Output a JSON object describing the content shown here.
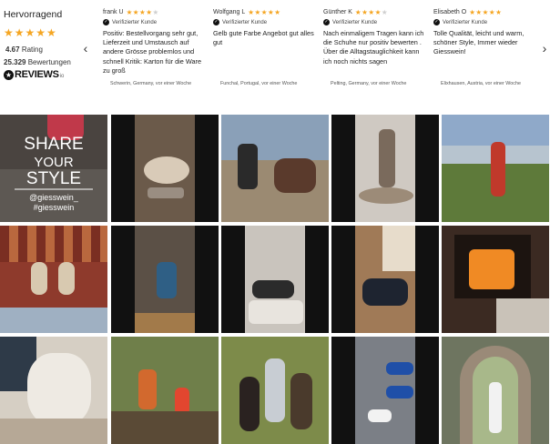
{
  "summary": {
    "title": "Hervorragend",
    "stars": "★★★★★",
    "rating_value": "4.67",
    "rating_label": "Rating",
    "count_value": "25.329",
    "count_label": "Bewertungen",
    "brand": "REVIEWS",
    "brand_suffix": "io"
  },
  "nav": {
    "prev": "‹",
    "next": "›"
  },
  "reviews": [
    {
      "name": "frank U",
      "stars_on": "★★★★",
      "stars_off": "★",
      "verified": "Verifizierter Kunde",
      "text": "Positiv: Bestellvorgang sehr gut, Lieferzeit und Umstausch auf andere Grösse problemlos und schnell Kritik: Karton für die Ware zu groß",
      "location": "Schwerin, Germany, vor einer Woche"
    },
    {
      "name": "Wolfgang L",
      "stars_on": "★★★★★",
      "stars_off": "",
      "verified": "Verifizierter Kunde",
      "text": "Gelb gute Farbe Angebot gut alles gut",
      "location": "Funchal, Portugal, vor einer Woche"
    },
    {
      "name": "Günther K",
      "stars_on": "★★★★",
      "stars_off": "★",
      "verified": "Verifizierter Kunde",
      "text": "Nach einmaligem Tragen kann ich die Schuhe nur positiv bewerten . Über die Alltagstauglichkeit kann ich noch nichts sagen",
      "location": "Pelting, Germany, vor einer Woche"
    },
    {
      "name": "Elisabeth O",
      "stars_on": "★★★★★",
      "stars_off": "",
      "verified": "Verifizierter Kunde",
      "text": "Tolle Qualität, leicht und warm, schöner Style, Immer wieder Giesswein!",
      "location": "Elixhausen, Austria, vor einer Woche"
    }
  ],
  "share_tile": {
    "line1": "SHARE",
    "line2": "YOUR",
    "line3": "STYLE",
    "handle": "@giesswein_",
    "hashtag": "#giesswein"
  },
  "photos": [
    {
      "name": "photo-dog-on-shoes",
      "bg": "#6b5a4a",
      "accent": "#d9cbb8"
    },
    {
      "name": "photo-man-with-pony",
      "bg": "#8aa0b8",
      "accent": "#3a3230"
    },
    {
      "name": "photo-woman-mirror-shoes",
      "bg": "#cfc9c2",
      "accent": "#7a6a5c"
    },
    {
      "name": "photo-woman-by-lake",
      "bg": "#8fa9c9",
      "accent": "#c0392b"
    },
    {
      "name": "photo-slippers-on-rug",
      "bg": "#8e3a2c",
      "accent": "#d8c9b0"
    },
    {
      "name": "photo-woman-sitting-hall",
      "bg": "#5b5046",
      "accent": "#2f5f85"
    },
    {
      "name": "photo-putting-on-shoes",
      "bg": "#c9c4bd",
      "accent": "#2b2b2b"
    },
    {
      "name": "photo-tying-sneaker",
      "bg": "#a07a57",
      "accent": "#1e2430"
    },
    {
      "name": "photo-fireplace-feet",
      "bg": "#3b2a22",
      "accent": "#f08a24"
    },
    {
      "name": "photo-fluffy-dog",
      "bg": "#d6cfc4",
      "accent": "#eeeae3"
    },
    {
      "name": "photo-two-kids-forest",
      "bg": "#6f7f4a",
      "accent": "#d2692e"
    },
    {
      "name": "photo-woman-with-alpacas",
      "bg": "#7d8b4a",
      "accent": "#4a3a2c"
    },
    {
      "name": "photo-blue-sneakers-tiles",
      "bg": "#7b7f86",
      "accent": "#1f4fa8"
    },
    {
      "name": "photo-woman-garden-arch",
      "bg": "#6e7560",
      "accent": "#f2f2f2"
    }
  ]
}
